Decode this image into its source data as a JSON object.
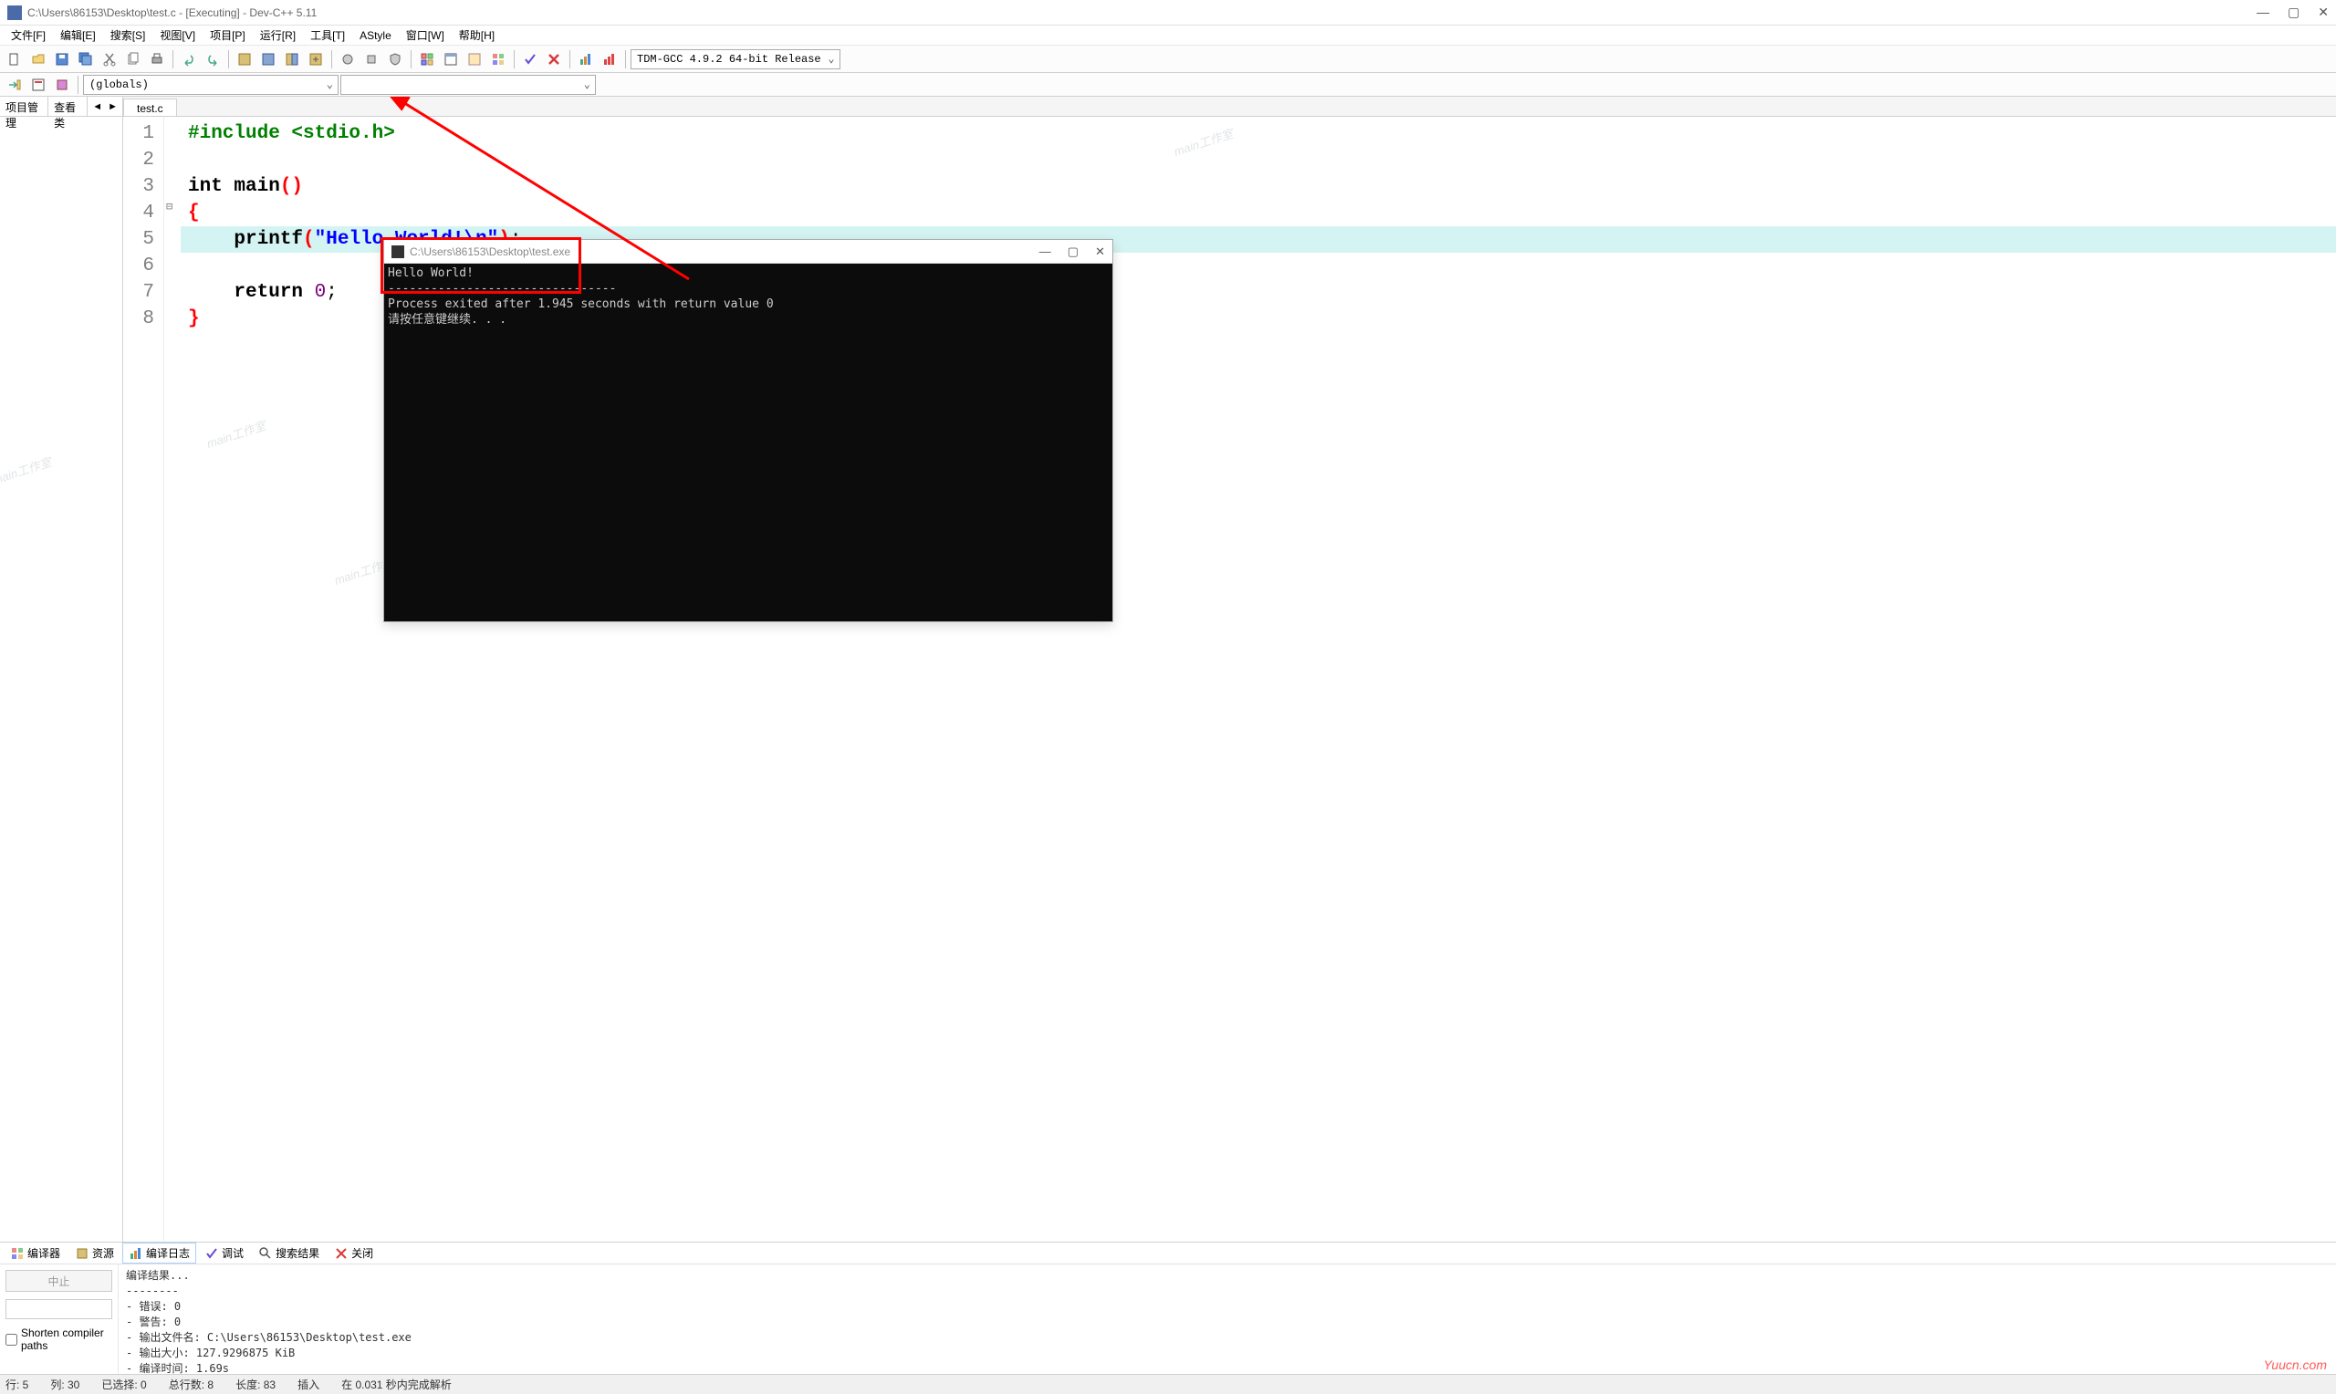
{
  "window": {
    "title": "C:\\Users\\86153\\Desktop\\test.c - [Executing] - Dev-C++ 5.11"
  },
  "menu": {
    "file": "文件[F]",
    "edit": "编辑[E]",
    "search": "搜索[S]",
    "view": "视图[V]",
    "project": "项目[P]",
    "run": "运行[R]",
    "tools": "工具[T]",
    "astyle": "AStyle",
    "window": "窗口[W]",
    "help": "帮助[H]"
  },
  "toolbar": {
    "combo_compiler": "TDM-GCC 4.9.2 64-bit Release",
    "combo_globals": "(globals)"
  },
  "side": {
    "tab_project": "项目管理",
    "tab_class": "查看类"
  },
  "file_tab": "test.c",
  "code": {
    "lines": [
      "1",
      "2",
      "3",
      "4",
      "5",
      "6",
      "7",
      "8"
    ],
    "l1_pp": "#include ",
    "l1_inc": "<stdio.h>",
    "l3_kw1": "int",
    "l3_fn": " main",
    "l3_paren": "()",
    "l4": "{",
    "l5_fn": "    printf",
    "l5_paren1": "(",
    "l5_str": "\"Hello World!\\n\"",
    "l5_paren2": ")",
    "l5_semi": ";",
    "l7_kw": "    return ",
    "l7_num": "0",
    "l7_semi": ";",
    "l8": "}"
  },
  "console": {
    "title": "C:\\Users\\86153\\Desktop\\test.exe",
    "line1": "Hello World!",
    "line2": "--------------------------------",
    "line3": "Process exited after 1.945 seconds with return value 0",
    "line4": "请按任意键继续. . ."
  },
  "bottom": {
    "tab_compiler": "编译器",
    "tab_resource": "资源",
    "tab_log": "编译日志",
    "tab_debug": "调试",
    "tab_search": "搜索结果",
    "tab_close": "关闭",
    "abort": "中止",
    "shorten": "Shorten compiler paths",
    "out_header": "编译结果...",
    "out_errors": "- 错误: 0",
    "out_warnings": "- 警告: 0",
    "out_file": "- 输出文件名: C:\\Users\\86153\\Desktop\\test.exe",
    "out_size": "- 输出大小: 127.9296875 KiB",
    "out_time": "- 编译时间: 1.69s"
  },
  "status": {
    "row": "行:    5",
    "col": "列:    30",
    "sel": "已选择:    0",
    "total": "总行数:    8",
    "len": "长度:    83",
    "insert": "插入",
    "parse": "在 0.031 秒内完成解析"
  },
  "watermark": "main工作室",
  "yuucn": "Yuucn.com"
}
